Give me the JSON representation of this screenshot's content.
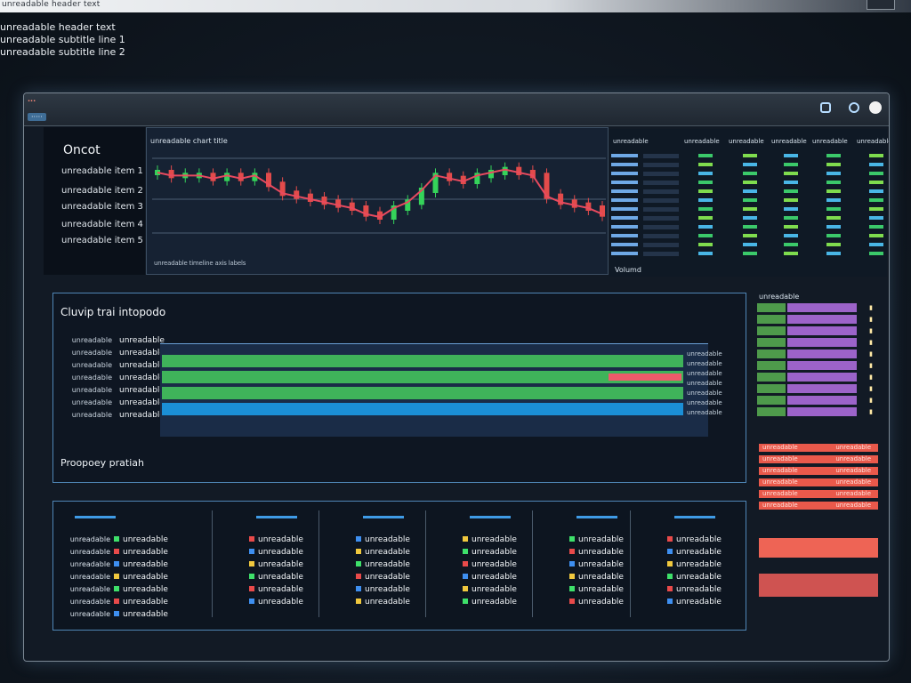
{
  "header": {
    "lines": [
      "unreadable header text",
      "unreadable subtitle line 1",
      "unreadable subtitle line 2"
    ]
  },
  "window": {
    "badge": "···",
    "tab": "·····",
    "controls": [
      "minimize-icon",
      "maximize-icon",
      "close-icon"
    ]
  },
  "sidebar": {
    "title": "Oncot",
    "items": [
      "unreadable item 1",
      "unreadable item 2",
      "unreadable item 3",
      "unreadable item 4",
      "unreadable item 5"
    ]
  },
  "chart": {
    "title": "unreadable chart title",
    "footer": "unreadable timeline axis labels",
    "chart_data": {
      "type": "line",
      "title": "",
      "xlabel": "",
      "ylabel": "",
      "series": [
        {
          "values": [
            54,
            53,
            53,
            53,
            52,
            53,
            52,
            53,
            50,
            47,
            46,
            45,
            44,
            43,
            42,
            40,
            39,
            42,
            44,
            48,
            53,
            52,
            51,
            53,
            54,
            55,
            54,
            53,
            46,
            44,
            43,
            42,
            40
          ]
        }
      ],
      "colors": {
        "up": "#35d35a",
        "down": "#e34b4b",
        "trend": "#e84a5f"
      },
      "grid": true
    }
  },
  "watchlist": {
    "headers": [
      "unreadable",
      "unreadable",
      "unreadable",
      "unreadable",
      "unreadable",
      "unreadable"
    ],
    "footer": "Volumd",
    "rows": 12
  },
  "middle": {
    "title": "Cluvip trai intopodo",
    "rows": [
      {
        "label": "unreadable",
        "value": "unreadable"
      },
      {
        "label": "unreadable",
        "value": "unreadable"
      },
      {
        "label": "unreadable",
        "value": "unreadable"
      },
      {
        "label": "unreadable",
        "value": "unreadable"
      },
      {
        "label": "unreadable",
        "value": "unreadable"
      },
      {
        "label": "unreadable",
        "value": "unreadable"
      },
      {
        "label": "unreadable",
        "value": "unreadable"
      }
    ],
    "bars": [
      {
        "color": "#3fb35a",
        "fill": 1.0
      },
      {
        "color": "#3fb35a",
        "fill": 1.0,
        "accent": "#f05a6a"
      },
      {
        "color": "#3fb35a",
        "fill": 1.0
      },
      {
        "color": "#1b8fd6",
        "fill": 1.0
      }
    ],
    "right_labels": [
      "unreadable",
      "unreadable",
      "unreadable",
      "unreadable",
      "unreadable",
      "unreadable",
      "unreadable"
    ],
    "footer": "Proopoey pratiah"
  },
  "order_ladder": {
    "title": "unreadable",
    "rows": 10
  },
  "sell_list": {
    "rows": [
      {
        "label": "unreadable",
        "value": "unreadable"
      },
      {
        "label": "unreadable",
        "value": "unreadable"
      },
      {
        "label": "unreadable",
        "value": "unreadable"
      },
      {
        "label": "unreadable",
        "value": "unreadable"
      },
      {
        "label": "unreadable",
        "value": "unreadable"
      },
      {
        "label": "unreadable",
        "value": "unreadable"
      }
    ]
  },
  "bottom": {
    "columns": [
      {
        "lines": [
          {
            "label": "unreadable",
            "value": "unreadable"
          },
          {
            "label": "unreadable",
            "value": "unreadable"
          },
          {
            "label": "unreadable",
            "value": "unreadable"
          },
          {
            "label": "unreadable",
            "value": "unreadable"
          },
          {
            "label": "unreadable",
            "value": "unreadable"
          },
          {
            "label": "unreadable",
            "value": "unreadable"
          },
          {
            "label": "unreadable",
            "value": "unreadable"
          }
        ]
      },
      {
        "lines": [
          {
            "label": "",
            "value": "unreadable"
          },
          {
            "label": "",
            "value": "unreadable"
          },
          {
            "label": "",
            "value": "unreadable"
          },
          {
            "label": "",
            "value": "unreadable"
          },
          {
            "label": "",
            "value": "unreadable"
          },
          {
            "label": "",
            "value": "unreadable"
          }
        ]
      },
      {
        "lines": [
          {
            "label": "",
            "value": "unreadable"
          },
          {
            "label": "",
            "value": "unreadable"
          },
          {
            "label": "",
            "value": "unreadable"
          },
          {
            "label": "",
            "value": "unreadable"
          },
          {
            "label": "",
            "value": "unreadable"
          },
          {
            "label": "",
            "value": "unreadable"
          }
        ]
      },
      {
        "lines": [
          {
            "label": "",
            "value": "unreadable"
          },
          {
            "label": "",
            "value": "unreadable"
          },
          {
            "label": "",
            "value": "unreadable"
          },
          {
            "label": "",
            "value": "unreadable"
          },
          {
            "label": "",
            "value": "unreadable"
          },
          {
            "label": "",
            "value": "unreadable"
          }
        ]
      },
      {
        "lines": [
          {
            "label": "",
            "value": "unreadable"
          },
          {
            "label": "",
            "value": "unreadable"
          },
          {
            "label": "",
            "value": "unreadable"
          },
          {
            "label": "",
            "value": "unreadable"
          },
          {
            "label": "",
            "value": "unreadable"
          },
          {
            "label": "",
            "value": "unreadable"
          }
        ]
      },
      {
        "lines": [
          {
            "label": "",
            "value": "unreadable"
          },
          {
            "label": "",
            "value": "unreadable"
          },
          {
            "label": "",
            "value": "unreadable"
          },
          {
            "label": "",
            "value": "unreadable"
          },
          {
            "label": "",
            "value": "unreadable"
          },
          {
            "label": "",
            "value": "unreadable"
          }
        ]
      }
    ],
    "icon_colors": [
      "#3ee06a",
      "#e84a4a",
      "#3e8ff0",
      "#f0c83e"
    ]
  }
}
